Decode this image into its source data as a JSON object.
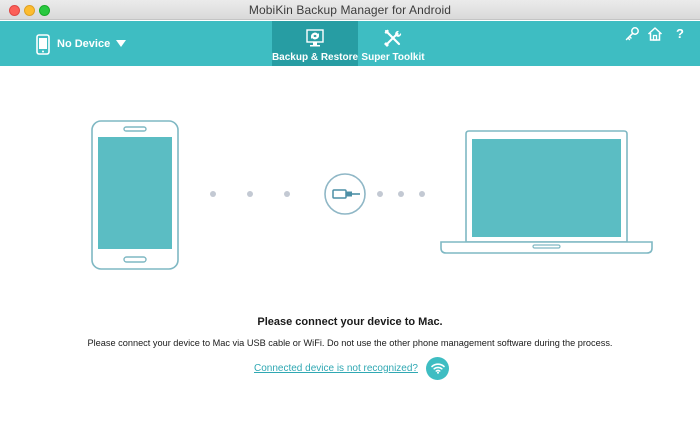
{
  "window": {
    "title": "MobiKin Backup Manager for Android"
  },
  "toolbar": {
    "device_label": "No Device",
    "tabs": [
      {
        "label": "Backup & Restore",
        "icon": "backup-restore-icon",
        "active": true
      },
      {
        "label": "Super Toolkit",
        "icon": "tools-icon",
        "active": false
      }
    ],
    "right_icons": [
      "key-icon",
      "home-icon",
      "help-icon"
    ],
    "help_glyph": "?"
  },
  "main": {
    "heading": "Please connect your device to Mac.",
    "instruction": "Please connect your device to Mac via USB cable or WiFi. Do not use the other phone management software during the process.",
    "help_link": "Connected device is not recognized?"
  },
  "colors": {
    "accent": "#3ebdc2",
    "accent_dark": "#279da3",
    "illustration_stroke": "#7fb8c3",
    "illustration_fill": "#5bbdc3",
    "dot": "#c3c9d3"
  }
}
